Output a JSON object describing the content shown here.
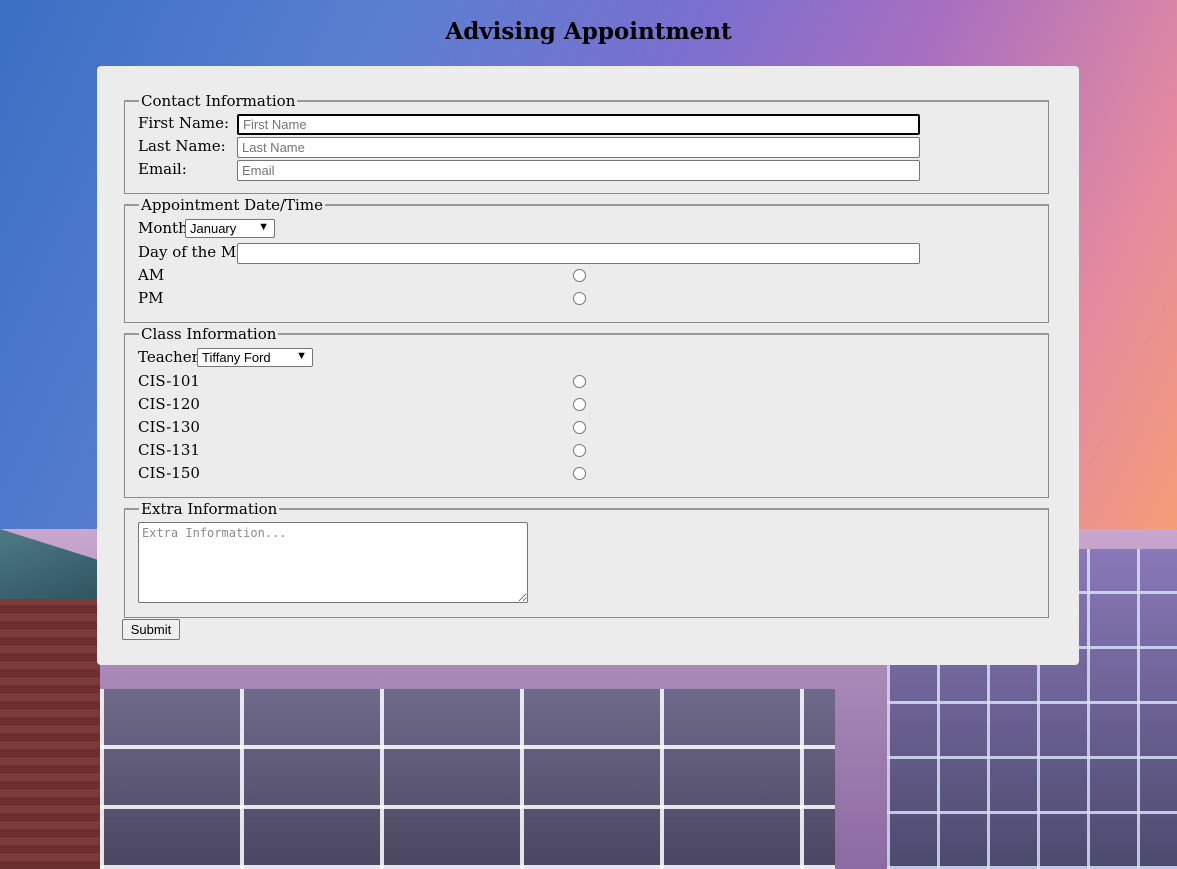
{
  "page_title": "Advising Appointment",
  "contact": {
    "legend": "Contact Information",
    "first_label": "First Name:",
    "first_placeholder": "First Name",
    "last_label": "Last Name:",
    "last_placeholder": "Last Name",
    "email_label": "Email:",
    "email_placeholder": "Email"
  },
  "appointment": {
    "legend": "Appointment Date/Time",
    "month_label": "Month",
    "month_value": "January",
    "day_label": "Day of the Month",
    "am_label": "AM",
    "pm_label": "PM"
  },
  "class_info": {
    "legend": "Class Information",
    "teacher_label": "Teacher:",
    "teacher_value": "Tiffany Ford",
    "classes": [
      "CIS-101",
      "CIS-120",
      "CIS-130",
      "CIS-131",
      "CIS-150"
    ]
  },
  "extra": {
    "legend": "Extra Information",
    "placeholder": "Extra Information..."
  },
  "submit_label": "Submit"
}
